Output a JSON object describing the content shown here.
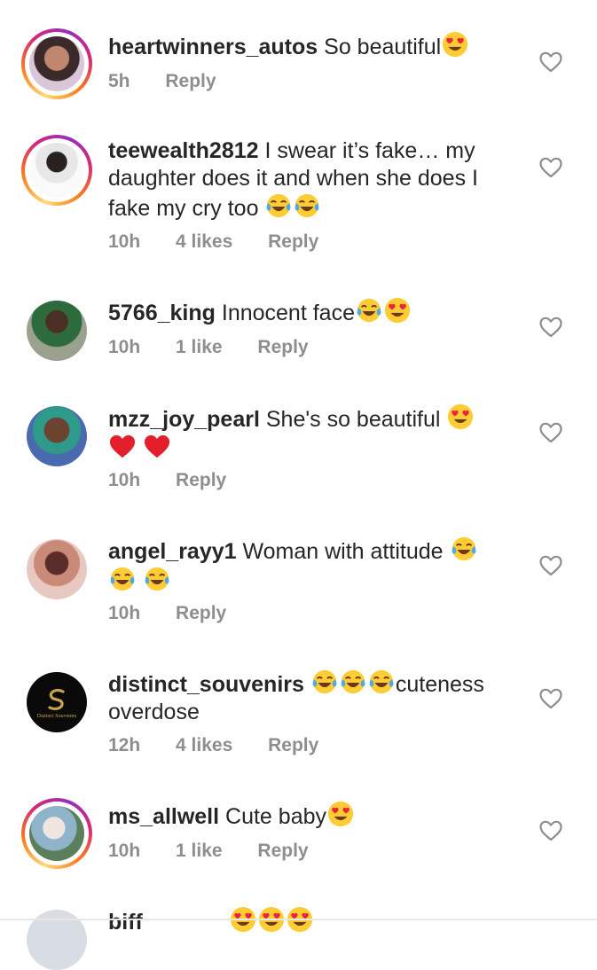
{
  "comments": [
    {
      "username": "heartwinners_autos",
      "text": "So beautiful",
      "emojis": [
        "heart-eyes"
      ],
      "time": "5h",
      "likes": "",
      "reply": "Reply"
    },
    {
      "username": "teewealth2812",
      "text": "I swear it’s fake… my daughter does it and when she does I fake my cry too",
      "emojis": [
        "tears-of-joy",
        "tears-of-joy"
      ],
      "time": "10h",
      "likes": "4 likes",
      "reply": "Reply"
    },
    {
      "username": "5766_king",
      "text": "Innocent face",
      "emojis": [
        "tears-of-joy",
        "heart-eyes"
      ],
      "time": "10h",
      "likes": "1 like",
      "reply": "Reply"
    },
    {
      "username": "mzz_joy_pearl",
      "text": "She's so beautiful",
      "emojis": [
        "heart-eyes",
        "red-heart",
        "red-heart"
      ],
      "time": "10h",
      "likes": "",
      "reply": "Reply"
    },
    {
      "username": "angel_rayy1",
      "text": "Woman with attitude",
      "emojis": [
        "tears-of-joy",
        "tears-of-joy",
        "tears-of-joy"
      ],
      "time": "10h",
      "likes": "",
      "reply": "Reply"
    },
    {
      "username": "distinct_souvenirs",
      "text": "cuteness overdose",
      "emojis": [
        "tears-of-joy",
        "tears-of-joy",
        "tears-of-joy"
      ],
      "time": "12h",
      "likes": "4 likes",
      "reply": "Reply"
    },
    {
      "username": "ms_allwell",
      "text": "Cute baby",
      "emojis": [
        "heart-eyes"
      ],
      "time": "10h",
      "likes": "1 like",
      "reply": "Reply"
    }
  ],
  "partial_next_username": "biff",
  "logo_text": "Distinct Souvenirs",
  "icons": {
    "like": "heart-outline-icon"
  },
  "colors": {
    "text": "#262626",
    "meta": "#8e8e8e",
    "story_ring": [
      "#feda75",
      "#fa7e1e",
      "#d62976",
      "#962fbf"
    ]
  }
}
